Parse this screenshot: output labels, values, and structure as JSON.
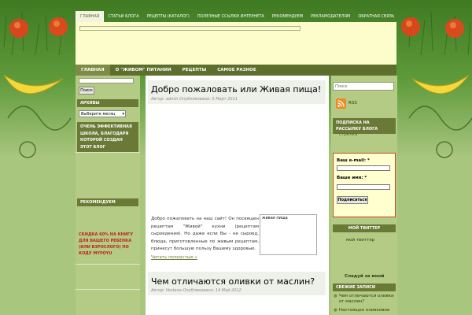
{
  "top_nav": [
    "ГЛАВНАЯ",
    "СТАТЬИ БЛОГА",
    "РЕЦЕПТЫ (КАТАЛОГ)",
    "ПОЛЕЗНЫЕ ССЫЛКИ ИНТЕРНЕТА",
    "РЕКОМЕНДУЕМ",
    "РЕКЛАМОДАТЕЛЯМ",
    "ОБРАТНАЯ СВЯЗЬ"
  ],
  "main_nav": [
    "ГЛАВНАЯ",
    "О \"ЖИВОМ\" ПИТАНИИ",
    "РЕЦЕПТЫ",
    "САМОЕ РАЗНОЕ"
  ],
  "left": {
    "search_button": "Поиск",
    "archives_title": "АРХИВЫ",
    "archives_select": "Выберите месяц",
    "widget_text": "ОЧЕНЬ ЭФФЕКТИВНАЯ ШКОЛА, БЛАГОДАРЯ КОТОРОЙ СОЗДАН ЭТОТ БЛОГ",
    "recommend_title": "РЕКОМЕНДУЕМ",
    "promo": "СКИДКА 60% НА КНИГУ ДЛЯ ВАШЕГО РЕБЕНКА (ИЛИ ВЗРОСЛОГО) ПО КОДУ MYPOYU"
  },
  "posts": [
    {
      "title": "Добро пожаловать или Живая пища!",
      "meta": "Автор: admin Опубликовано: 5 Март 2011",
      "body": "Добро пожаловать на наш сайт! Он посвящен рецептам \"Живой\" кухни (рецептам сыроедения). Но даже если Вы - не сыроед, блюда, приготовленные по живым рецептам, принесут большую пользу Вашему здоровью.",
      "image_caption": "живая пища",
      "read_more": "Читать полностью »"
    },
    {
      "title": "Чем отличаются оливки от маслин?",
      "meta": "Автор: Vestana Опубликовано: 14 Май 2012"
    }
  ],
  "right": {
    "search_placeholder": "Поиск",
    "rss": "RSS",
    "subscribe_title": "ПОДПИСКА НА РАССЫЛКУ БЛОГА",
    "subscribe_link": "стрелка",
    "email_label": "Ваш e-mail: *",
    "name_label": "Ваше имя: *",
    "subscribe_button": "Подписаться",
    "twitter_title": "МОЙ ТВИТТЕР",
    "twitter_text": "мой твиттер",
    "follow": "Следуй за мной",
    "recent_title": "СВЕЖИЕ ЗАПИСИ",
    "recent": [
      "Чем отличаются оливки от маслин?",
      "Настоящее оливковое"
    ]
  }
}
